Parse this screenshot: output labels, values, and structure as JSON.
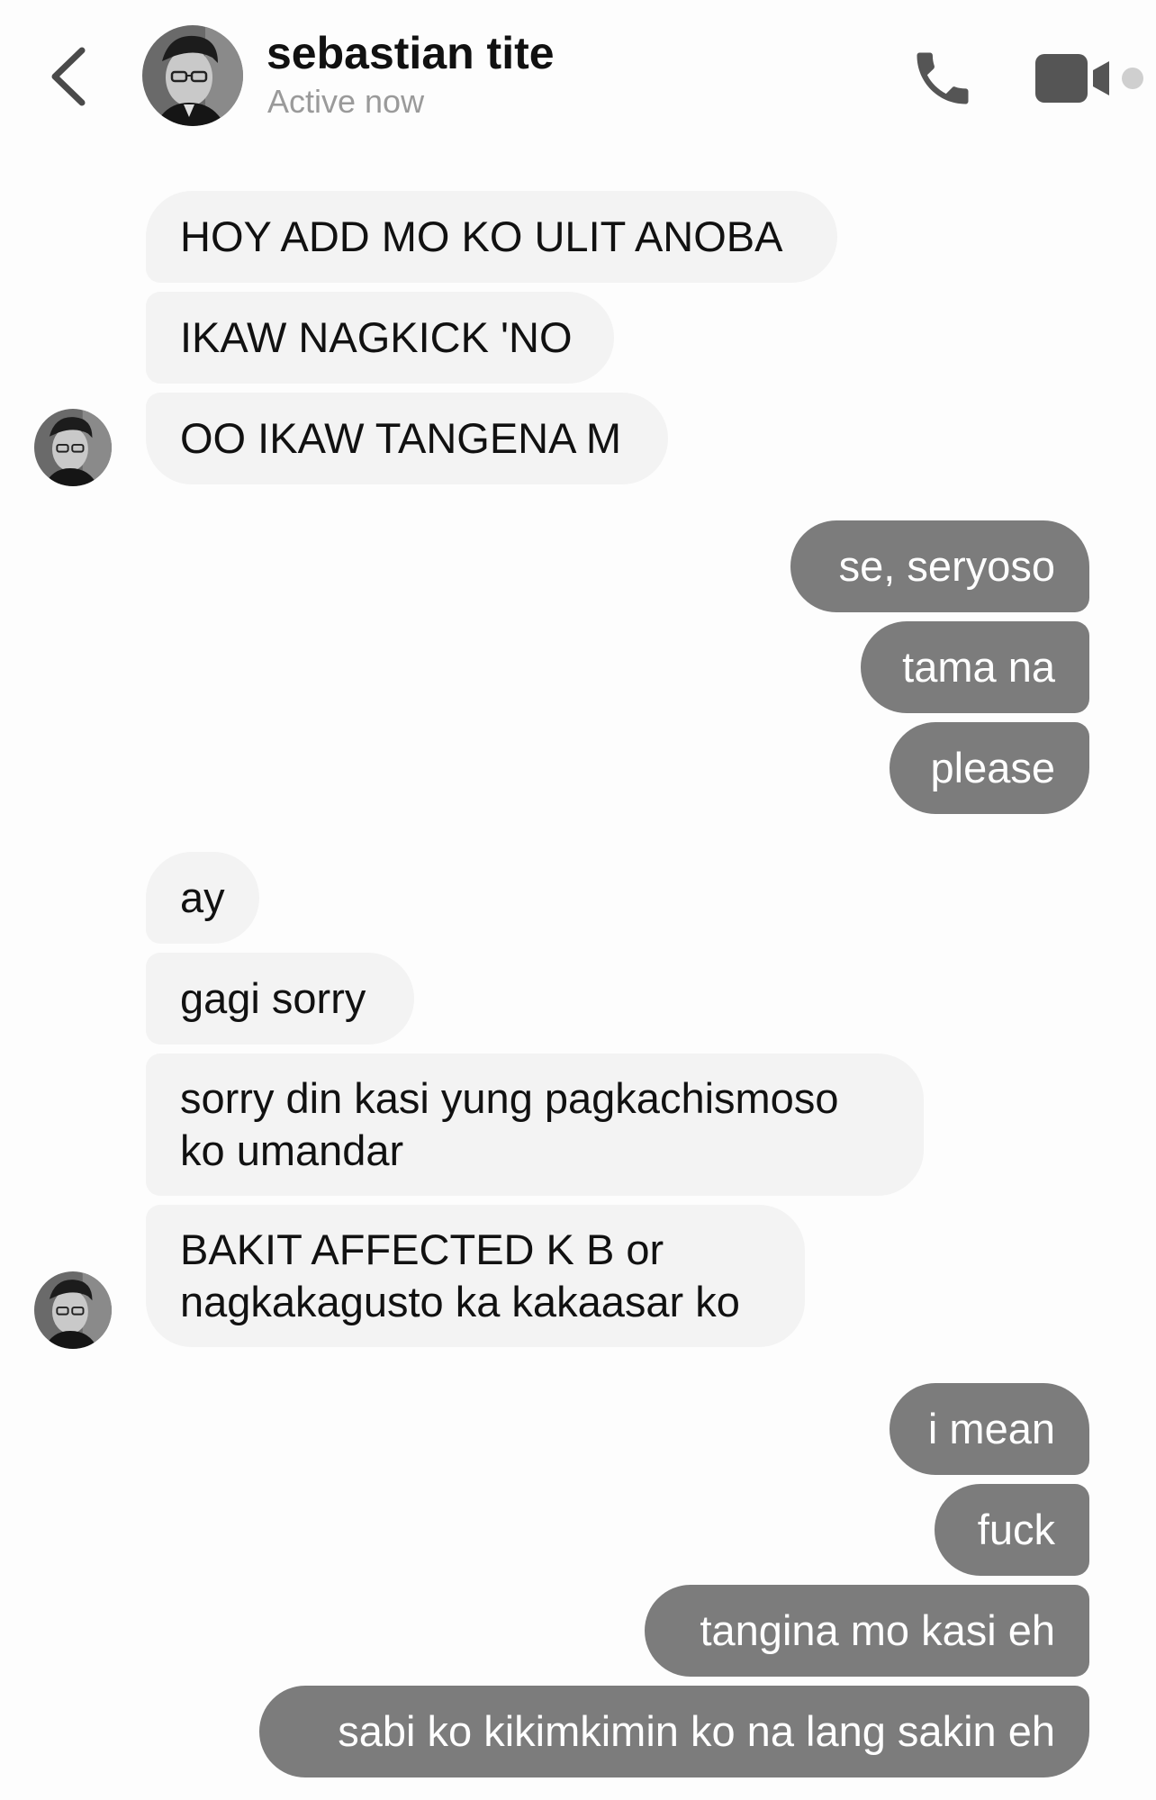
{
  "header": {
    "name": "sebastian tite",
    "status": "Active now",
    "back_icon": "chevron-left-icon",
    "call_icon": "phone-icon",
    "video_icon": "video-camera-icon",
    "accent_color": "#7c7c7c"
  },
  "messages": {
    "in1": "HOY ADD MO KO ULIT ANOBA",
    "in2": "IKAW NAGKICK 'NO",
    "in3": "OO IKAW TANGENA M",
    "out1": "se, seryoso",
    "out2": "tama na",
    "out3": "please",
    "in4": "ay",
    "in5": "gagi sorry",
    "in6_line1": "sorry din kasi yung pagkachismoso",
    "in6_line2": "ko umandar",
    "in7_line1": "BAKIT AFFECTED K B or",
    "in7_line2": "nagkakagusto ka kakaasar ko",
    "out4": "i mean",
    "out5": "fuck",
    "out6": "tangina mo kasi eh",
    "out7": "sabi ko kikimkimin ko na lang sakin eh"
  },
  "colors": {
    "incoming_bubble": "#f3f3f3",
    "outgoing_bubble": "#7c7c7c",
    "background": "#fdfdfd"
  }
}
